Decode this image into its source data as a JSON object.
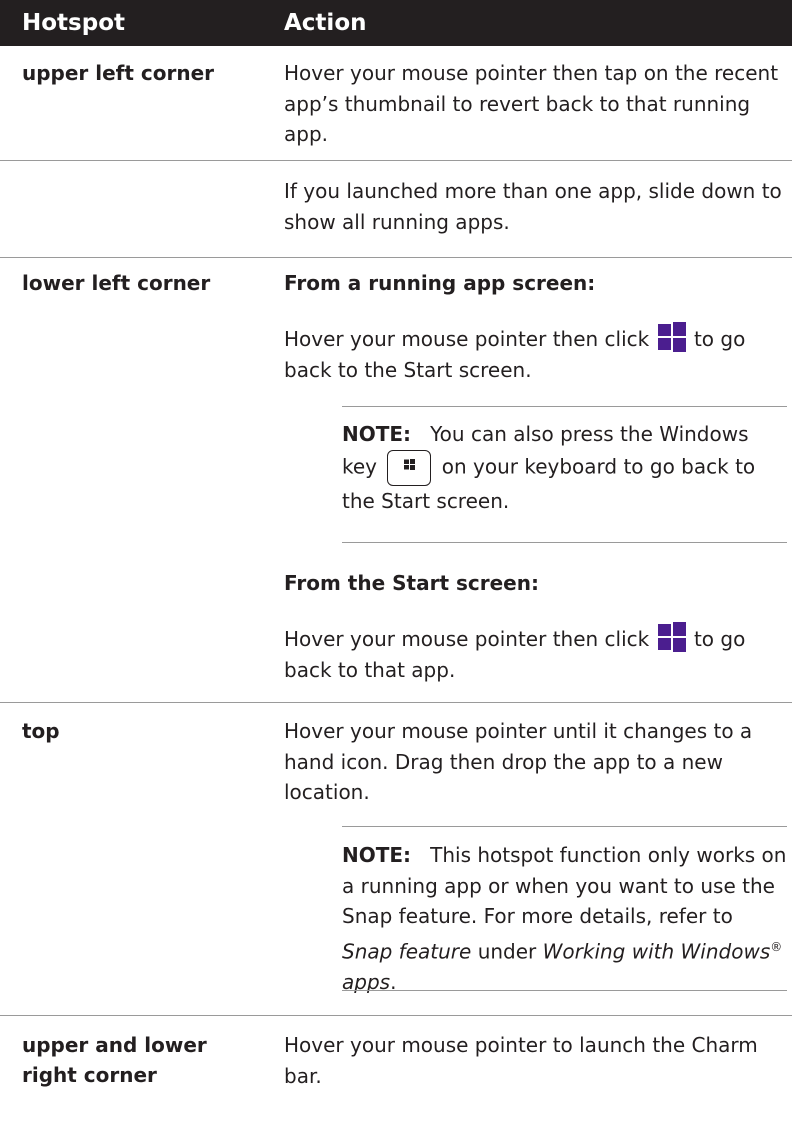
{
  "header": {
    "hotspot": "Hotspot",
    "action": "Action"
  },
  "rows": [
    {
      "hotspot": "upper left corner",
      "action": "Hover your mouse pointer then tap on the recent app’s thumbnail to revert back to that running app."
    },
    {
      "hotspot": "",
      "action": "If you launched more than one app, slide down to show all running apps."
    },
    {
      "hotspot": "lower left corner",
      "sub1": "From a running app screen:",
      "text1_a": "Hover your mouse pointer then click",
      "text1_b": "to go back to the Start screen.",
      "note": {
        "label": "NOTE:",
        "text_a": "You can also press the Windows key",
        "text_b": "on your keyboard to go back to the Start screen."
      },
      "sub2": "From the Start screen:",
      "text2_a": "Hover your mouse pointer then click",
      "text2_b": "to go back to that app."
    },
    {
      "hotspot": "top",
      "action": "Hover your mouse pointer until it changes to a hand icon. Drag then drop the app to a new location.",
      "note": {
        "label": "NOTE:",
        "text_a": "This hotspot function only works on a running app or when you want to use the Snap feature. For more details, refer to",
        "link1": "Snap feature",
        "mid": "under",
        "link2": "Working with Windows",
        "reg": "®",
        "link3": "apps",
        "end": "."
      }
    },
    {
      "hotspot_line1": "upper and lower",
      "hotspot_line2": "right corner",
      "action": "Hover your mouse pointer to launch the Charm bar."
    }
  ],
  "icons": {
    "windows_logo_color": "#4b1e8f",
    "windows_logo": "windows-logo-icon",
    "windows_key": "windows-key-icon"
  }
}
